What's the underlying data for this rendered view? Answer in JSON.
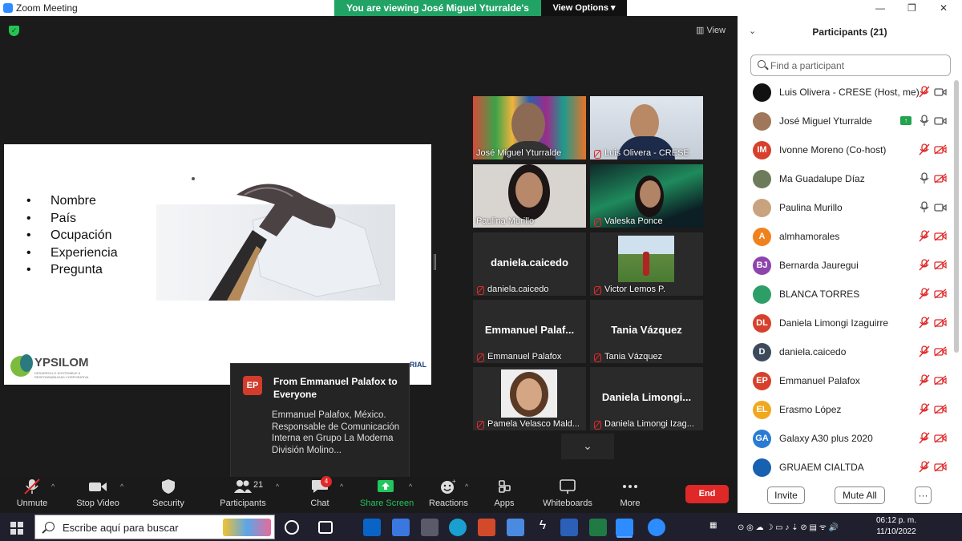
{
  "window": {
    "title": "Zoom Meeting"
  },
  "banner": {
    "message": "You are viewing José Miguel Yturralde's screen",
    "options_label": "View Options ▾"
  },
  "view_label": "View",
  "shared_slide": {
    "bullets": [
      "Nombre",
      "País",
      "Ocupación",
      "Experiencia",
      "Pregunta"
    ],
    "logo_text": "YPSILOM",
    "logo_subtext": "DESARROLLO SOSTENIBLE & RESPONSABILIDAD CORPORATIVA",
    "corner_text": "RIAL"
  },
  "tiles": [
    {
      "name": "José Miguel Yturralde",
      "active": true,
      "muted": false,
      "video": true
    },
    {
      "name": "Luis Olivera - CRESE",
      "muted": true,
      "video": true
    },
    {
      "name": "Paulina Murillo",
      "muted": false,
      "video": true
    },
    {
      "name": "Valeska Ponce",
      "muted": true,
      "video": true
    },
    {
      "name": "daniela.caicedo",
      "muted": true,
      "video": false,
      "big": "daniela.caicedo"
    },
    {
      "name": "Victor Lemos P.",
      "muted": true,
      "video": true
    },
    {
      "name": "Emmanuel Palafox",
      "muted": true,
      "video": false,
      "big": "Emmanuel  Palaf..."
    },
    {
      "name": "Tania Vázquez",
      "muted": true,
      "video": false,
      "big": "Tania Vázquez"
    },
    {
      "name": "Pamela Velasco Mald...",
      "muted": true,
      "video": true
    },
    {
      "name": "Daniela Limongi Izag...",
      "muted": true,
      "video": false,
      "big": "Daniela  Limongi..."
    }
  ],
  "chat_toast": {
    "initials": "EP",
    "from": "From Emmanuel Palafox to Everyone",
    "message": "Emmanuel Palafox, México. Responsable de Comunicación Interna en Grupo La Moderna División Molino..."
  },
  "toolbar": {
    "unmute": "Unmute",
    "stop_video": "Stop Video",
    "security": "Security",
    "participants": "Participants",
    "participants_count": "21",
    "chat": "Chat",
    "chat_badge": "4",
    "share_screen": "Share Screen",
    "reactions": "Reactions",
    "apps": "Apps",
    "whiteboards": "Whiteboards",
    "more": "More",
    "end": "End"
  },
  "panel": {
    "title": "Participants (21)",
    "search_placeholder": "Find a participant",
    "invite": "Invite",
    "mute_all": "Mute All",
    "more": "···",
    "participants": [
      {
        "name": "Luis Olivera - CRESE (Host, me)",
        "initials": "",
        "color": "#111111",
        "muted": true,
        "video_off": false
      },
      {
        "name": "José Miguel Yturralde",
        "initials": "",
        "color": "#a0775a",
        "muted": false,
        "video_off": false,
        "sharing": true
      },
      {
        "name": "Ivonne Moreno (Co-host)",
        "initials": "IM",
        "color": "#d6402c",
        "muted": true,
        "video_off": true
      },
      {
        "name": "Ma Guadalupe Díaz",
        "initials": "",
        "color": "#6d7b5a",
        "muted": false,
        "video_off": true
      },
      {
        "name": "Paulina Murillo",
        "initials": "",
        "color": "#c9a27e",
        "muted": false,
        "video_off": false
      },
      {
        "name": "almhamorales",
        "initials": "A",
        "color": "#f0821e",
        "muted": true,
        "video_off": true
      },
      {
        "name": "Bernarda Jauregui",
        "initials": "BJ",
        "color": "#8e44ad",
        "muted": true,
        "video_off": true
      },
      {
        "name": "BLANCA TORRES",
        "initials": "",
        "color": "#2e9e68",
        "muted": true,
        "video_off": true
      },
      {
        "name": "Daniela Limongi Izaguirre",
        "initials": "DL",
        "color": "#d6402c",
        "muted": true,
        "video_off": true
      },
      {
        "name": "daniela.caicedo",
        "initials": "D",
        "color": "#3d4a5c",
        "muted": true,
        "video_off": true
      },
      {
        "name": "Emmanuel Palafox",
        "initials": "EP",
        "color": "#d6402c",
        "muted": true,
        "video_off": true
      },
      {
        "name": "Erasmo López",
        "initials": "EL",
        "color": "#f0a81e",
        "muted": true,
        "video_off": true
      },
      {
        "name": "Galaxy A30 plus 2020",
        "initials": "GA",
        "color": "#2a7bd4",
        "muted": true,
        "video_off": true
      },
      {
        "name": "GRUAEM CIALTDA",
        "initials": "",
        "color": "#1860b0",
        "muted": true,
        "video_off": true
      }
    ]
  },
  "taskbar": {
    "search_text": "Escribe aquí para buscar",
    "time": "06:12 p. m.",
    "date": "11/10/2022"
  }
}
